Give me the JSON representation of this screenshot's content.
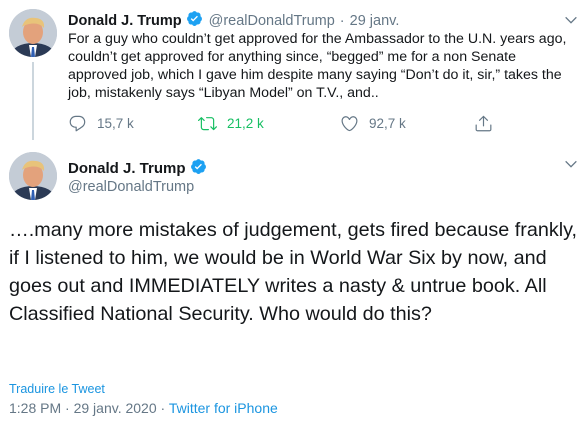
{
  "colors": {
    "text_primary": "#14171a",
    "text_secondary": "#657786",
    "link": "#1b95e0",
    "retweet_active": "#17bf63",
    "verified_badge": "#1da1f2",
    "thread_line": "#ccd6dd"
  },
  "tweet1": {
    "display_name": "Donald J. Trump",
    "handle": "@realDonaldTrump",
    "separator": "·",
    "date": "29 janv.",
    "text": "For a guy who couldn’t get approved for the Ambassador to the U.N. years ago, couldn’t get approved for anything since, “begged” me for a non Senate approved job, which I gave him despite many saying “Don’t do it, sir,” takes the job, mistakenly says “Libyan Model” on T.V., and..",
    "actions": {
      "reply": {
        "icon": "reply-icon",
        "count": "15,7 k"
      },
      "retweet": {
        "icon": "retweet-icon",
        "count": "21,2 k"
      },
      "like": {
        "icon": "heart-icon",
        "count": "92,7 k"
      },
      "share": {
        "icon": "share-icon"
      }
    }
  },
  "tweet2": {
    "display_name": "Donald J. Trump",
    "handle": "@realDonaldTrump",
    "text": "….many more mistakes of judgement, gets fired because frankly, if I listened to him, we would be in World War Six by now, and goes out and IMMEDIATELY writes a nasty & untrue book. All Classified National Security. Who would do this?",
    "translate_label": "Traduire le Tweet",
    "time": "1:28 PM",
    "date": "29 janv. 2020",
    "separator": "·",
    "source": "Twitter for iPhone"
  }
}
